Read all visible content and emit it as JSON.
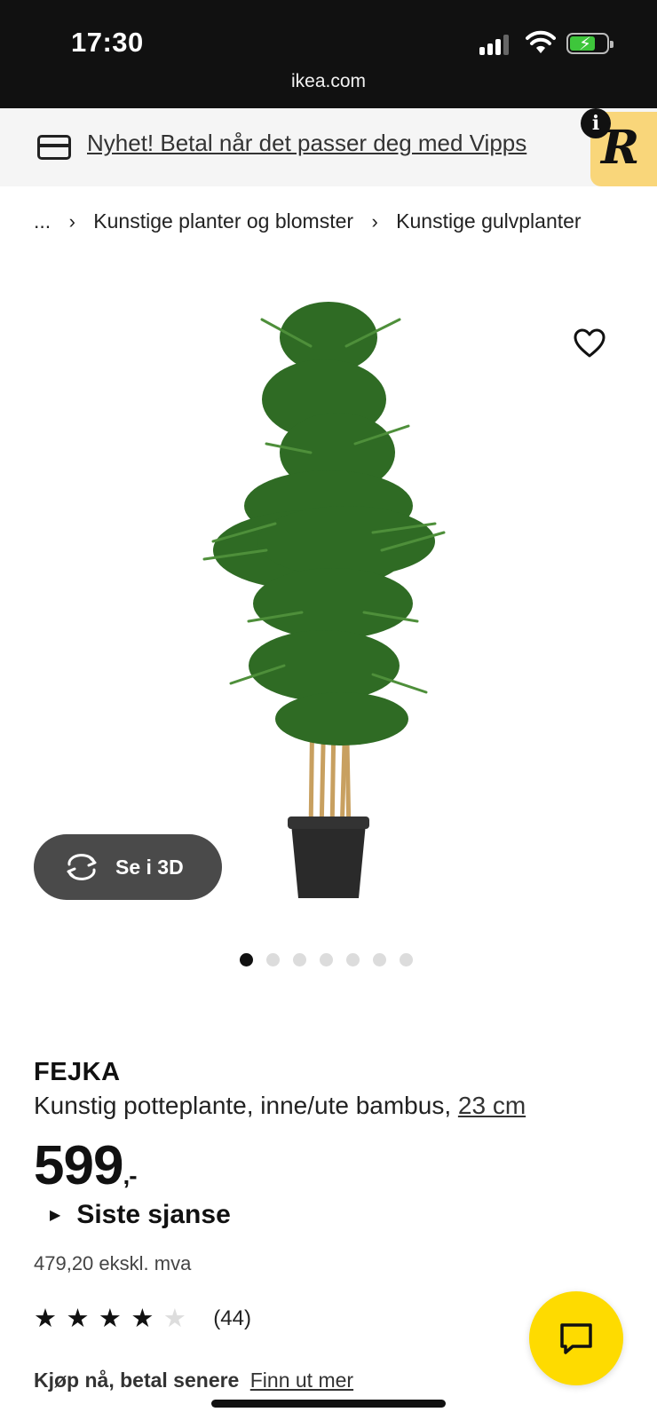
{
  "status_bar": {
    "time": "17:30",
    "url": "ikea.com",
    "icons": [
      "signal-icon",
      "wifi-icon",
      "battery-charging-icon"
    ]
  },
  "banner": {
    "icon": "credit-card-icon",
    "text": "Nyhet! Betal når det passer deg med Vipps",
    "badge_letter": "R",
    "info_letter": "i"
  },
  "breadcrumb": {
    "ellipsis": "...",
    "items": [
      "Kunstige planter og blomster",
      "Kunstige gulvplanter"
    ]
  },
  "gallery": {
    "image_alt": "bamboo-plant-in-pot",
    "view_3d_label": "Se i 3D",
    "slide_count": 7,
    "active_slide": 1
  },
  "product": {
    "brand": "FEJKA",
    "description": "Kunstig potteplante, inne/ute bambus,",
    "size": "23 cm",
    "price": "599",
    "price_suffix": ",-",
    "badge": "Siste sjanse",
    "price_excl_vat": "479,20 ekskl. mva",
    "rating": 4,
    "rating_max": 5,
    "review_count": "(44)"
  },
  "payment": {
    "label": "Kjøp nå, betal senere",
    "link": "Finn ut mer"
  },
  "colors": {
    "status_bar_bg": "#111111",
    "chat_button": "#fedb00",
    "badge_bg": "#f9d67a",
    "button_3d_bg": "#4a4a4a"
  }
}
